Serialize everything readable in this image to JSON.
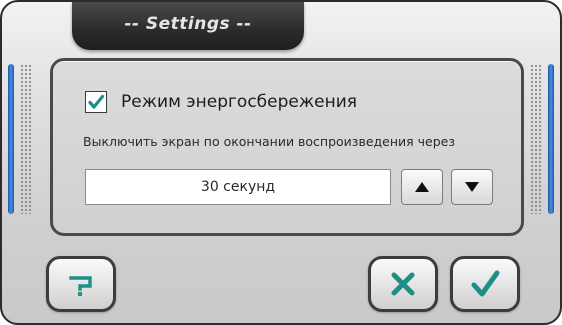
{
  "window": {
    "title": "-- Settings --"
  },
  "power_saving": {
    "checked": true,
    "label": "Режим энергосбережения",
    "description": "Выключить экран по окончании воспроизведения через",
    "value": "30 секунд"
  },
  "icons": {
    "increase": "triangle-up-icon",
    "decrease": "triangle-down-icon",
    "help": "help-icon",
    "cancel": "close-icon",
    "ok": "checkmark-icon"
  },
  "colors": {
    "accent": "#1e8f86",
    "title_bar": "#2b2b2b",
    "side_accent": "#2f74cf"
  }
}
